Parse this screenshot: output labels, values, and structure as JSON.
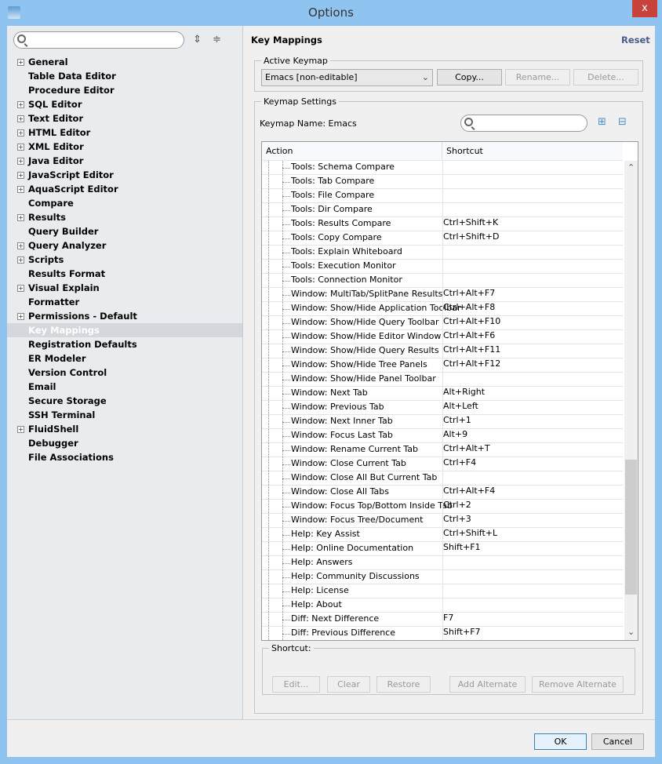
{
  "window": {
    "title": "Options",
    "close": "x"
  },
  "sidebar": {
    "items": [
      {
        "label": "General",
        "expandable": true
      },
      {
        "label": "Table Data Editor"
      },
      {
        "label": "Procedure Editor"
      },
      {
        "label": "SQL Editor",
        "expandable": true
      },
      {
        "label": "Text Editor",
        "expandable": true
      },
      {
        "label": "HTML Editor",
        "expandable": true
      },
      {
        "label": "XML Editor",
        "expandable": true
      },
      {
        "label": "Java Editor",
        "expandable": true
      },
      {
        "label": "JavaScript Editor",
        "expandable": true
      },
      {
        "label": "AquaScript Editor",
        "expandable": true
      },
      {
        "label": "Compare"
      },
      {
        "label": "Results",
        "expandable": true
      },
      {
        "label": "Query Builder"
      },
      {
        "label": "Query Analyzer",
        "expandable": true
      },
      {
        "label": "Scripts",
        "expandable": true
      },
      {
        "label": "Results Format"
      },
      {
        "label": "Visual Explain",
        "expandable": true
      },
      {
        "label": "Formatter"
      },
      {
        "label": "Permissions - Default",
        "expandable": true
      },
      {
        "label": "Key Mappings",
        "selected": true
      },
      {
        "label": "Registration Defaults"
      },
      {
        "label": "ER Modeler"
      },
      {
        "label": "Version Control"
      },
      {
        "label": "Email"
      },
      {
        "label": "Secure Storage"
      },
      {
        "label": "SSH Terminal"
      },
      {
        "label": "FluidShell",
        "expandable": true
      },
      {
        "label": "Debugger"
      },
      {
        "label": "File Associations"
      }
    ]
  },
  "main": {
    "title": "Key Mappings",
    "reset": "Reset",
    "active_keymap": {
      "legend": "Active Keymap",
      "selected": "Emacs [non-editable]",
      "copy": "Copy...",
      "rename": "Rename...",
      "delete": "Delete..."
    },
    "settings": {
      "legend": "Keymap Settings",
      "keymap_name": "Keymap Name: Emacs",
      "search_placeholder": "",
      "columns": [
        "Action",
        "Shortcut"
      ],
      "rows": [
        [
          "Tools: Schema Compare",
          ""
        ],
        [
          "Tools: Tab Compare",
          ""
        ],
        [
          "Tools: File Compare",
          ""
        ],
        [
          "Tools: Dir Compare",
          ""
        ],
        [
          "Tools: Results Compare",
          "Ctrl+Shift+K"
        ],
        [
          "Tools: Copy Compare",
          "Ctrl+Shift+D"
        ],
        [
          "Tools: Explain Whiteboard",
          ""
        ],
        [
          "Tools: Execution Monitor",
          ""
        ],
        [
          "Tools: Connection Monitor",
          ""
        ],
        [
          "Window: MultiTab/SplitPane Results",
          "Ctrl+Alt+F7"
        ],
        [
          "Window: Show/Hide Application Toolbar",
          "Ctrl+Alt+F8"
        ],
        [
          "Window: Show/Hide Query Toolbar",
          "Ctrl+Alt+F10"
        ],
        [
          "Window: Show/Hide Editor Window",
          "Ctrl+Alt+F6"
        ],
        [
          "Window: Show/Hide Query Results",
          "Ctrl+Alt+F11"
        ],
        [
          "Window: Show/Hide Tree Panels",
          "Ctrl+Alt+F12"
        ],
        [
          "Window: Show/Hide Panel Toolbar",
          ""
        ],
        [
          "Window: Next Tab",
          "Alt+Right"
        ],
        [
          "Window: Previous Tab",
          "Alt+Left"
        ],
        [
          "Window: Next Inner Tab",
          "Ctrl+1"
        ],
        [
          "Window: Focus Last Tab",
          "Alt+9"
        ],
        [
          "Window: Rename Current Tab",
          "Ctrl+Alt+T"
        ],
        [
          "Window: Close Current Tab",
          "Ctrl+F4"
        ],
        [
          "Window: Close All But Current Tab",
          ""
        ],
        [
          "Window: Close All Tabs",
          "Ctrl+Alt+F4"
        ],
        [
          "Window: Focus Top/Bottom Inside Tab",
          "Ctrl+2"
        ],
        [
          "Window: Focus Tree/Document",
          "Ctrl+3"
        ],
        [
          "Help: Key Assist",
          "Ctrl+Shift+L"
        ],
        [
          "Help: Online Documentation",
          "Shift+F1"
        ],
        [
          "Help: Answers",
          ""
        ],
        [
          "Help: Community Discussions",
          ""
        ],
        [
          "Help: License",
          ""
        ],
        [
          "Help: About",
          ""
        ],
        [
          "Diff: Next Difference",
          "F7"
        ],
        [
          "Diff: Previous Difference",
          "Shift+F7"
        ]
      ]
    },
    "shortcut": {
      "legend": "Shortcut:",
      "edit": "Edit...",
      "clear": "Clear",
      "restore": "Restore",
      "add_alternate": "Add Alternate",
      "remove_alternate": "Remove Alternate"
    }
  },
  "footer": {
    "ok": "OK",
    "cancel": "Cancel"
  }
}
